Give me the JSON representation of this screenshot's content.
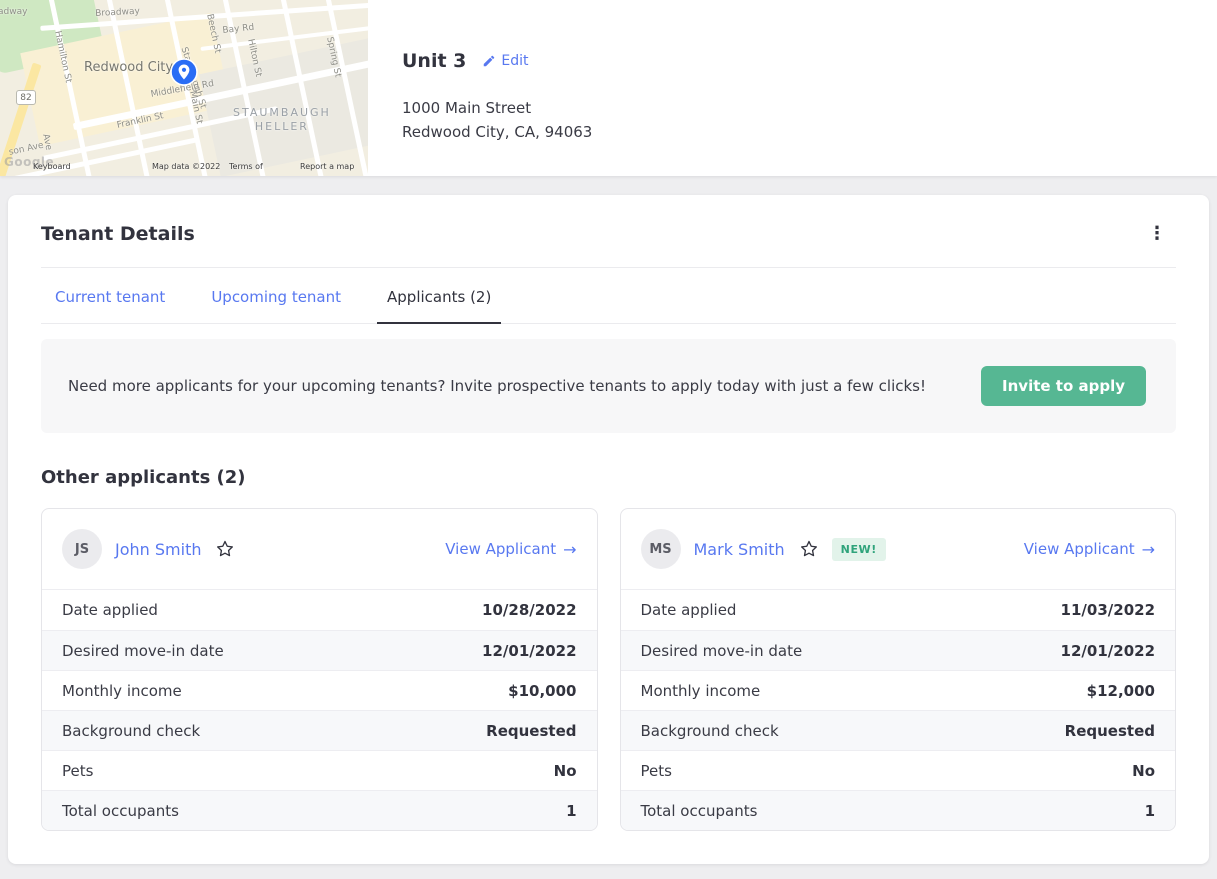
{
  "colors": {
    "accent_blue": "#5878f0",
    "accent_green": "#56b793",
    "text_dark": "#32333e",
    "new_badge_bg": "#e2f3ea",
    "new_badge_text": "#2fa37b"
  },
  "unit_header": {
    "title": "Unit 3",
    "edit_label": "Edit",
    "address_line1": "1000 Main Street",
    "address_line2": "Redwood City, CA, 94063",
    "map": {
      "labels": {
        "broadway_cut": "adway",
        "broadway": "Broadway",
        "bay_rd": "Bay Rd",
        "beech_st": "Beech St",
        "spring_st": "Spring St",
        "hilton_st": "Hilton St",
        "hamilton_st": "Hamilton St",
        "stambaugh_st": "Stambaugh St",
        "redwood_city": "Redwood City",
        "middlefield_rd": "Middlefield Rd",
        "main_st": "Main St",
        "staumbaugh": "STAUMBAUGH",
        "heller": "HELLER",
        "franklin_st": "Franklin St",
        "ave": "Ave",
        "son_ave": "son Ave",
        "route_82": "82",
        "watermark": "Google"
      },
      "attribution": {
        "keyboard": "Keyboard",
        "map_data": "Map data ©2022",
        "terms": "Terms of",
        "report": "Report a map"
      }
    }
  },
  "tenant_details": {
    "title": "Tenant Details",
    "menu_icon": "⋮",
    "tabs": [
      {
        "label": "Current tenant"
      },
      {
        "label": "Upcoming tenant"
      },
      {
        "label": "Applicants (2)"
      }
    ],
    "banner": {
      "text": "Need more applicants for your upcoming tenants? Invite prospective tenants to apply today with just a few clicks!",
      "button_label": "Invite to apply"
    },
    "section_title": "Other applicants (2)",
    "view_arrow": "→",
    "applicants": [
      {
        "initials": "JS",
        "name": "John Smith",
        "badge": "",
        "view_label": "View Applicant",
        "rows": [
          {
            "label": "Date applied",
            "value": "10/28/2022"
          },
          {
            "label": "Desired move-in date",
            "value": "12/01/2022"
          },
          {
            "label": "Monthly income",
            "value": "$10,000"
          },
          {
            "label": "Background check",
            "value": "Requested"
          },
          {
            "label": "Pets",
            "value": "No"
          },
          {
            "label": "Total occupants",
            "value": "1"
          }
        ]
      },
      {
        "initials": "MS",
        "name": "Mark Smith",
        "badge": "NEW!",
        "view_label": "View Applicant",
        "rows": [
          {
            "label": "Date applied",
            "value": "11/03/2022"
          },
          {
            "label": "Desired move-in date",
            "value": "12/01/2022"
          },
          {
            "label": "Monthly income",
            "value": "$12,000"
          },
          {
            "label": "Background check",
            "value": "Requested"
          },
          {
            "label": "Pets",
            "value": "No"
          },
          {
            "label": "Total occupants",
            "value": "1"
          }
        ]
      }
    ]
  }
}
